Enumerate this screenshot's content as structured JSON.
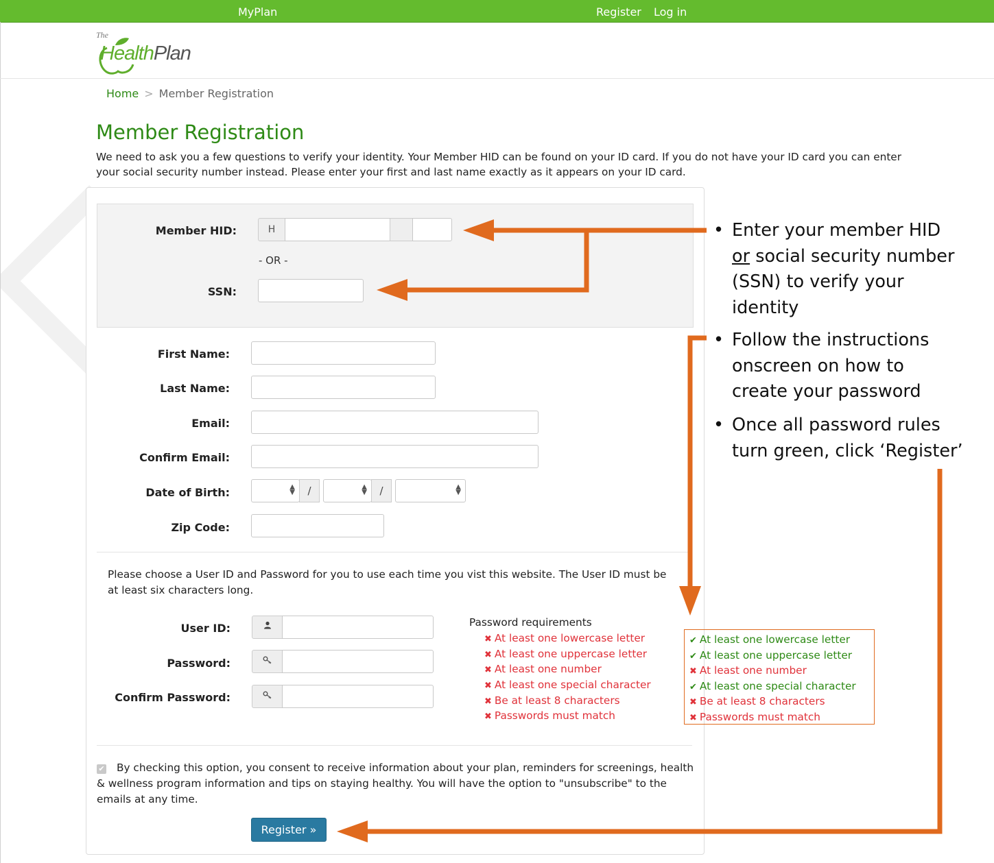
{
  "topbar": {
    "brand": "MyPlan",
    "register": "Register",
    "login": "Log in",
    "color": "#64bb2e"
  },
  "logo": {
    "the": "The",
    "health": "Health",
    "plan": "Plan"
  },
  "breadcrumb": {
    "home": "Home",
    "separator": ">",
    "current": "Member Registration"
  },
  "page": {
    "title": "Member Registration",
    "intro": "We need to ask you a few questions to verify your identity. Your Member HID can be found on your ID card. If you do not have your ID card you can enter your social security number instead. Please enter your first and last name exactly as it appears on your ID card."
  },
  "identity": {
    "hid_label": "Member HID:",
    "hid_prefix": "H",
    "or_text": "- OR -",
    "ssn_label": "SSN:"
  },
  "fields": {
    "first_name": "First Name:",
    "last_name": "Last Name:",
    "email": "Email:",
    "confirm_email": "Confirm Email:",
    "dob": "Date of Birth:",
    "dob_sep": "/",
    "zip": "Zip Code:"
  },
  "credentials": {
    "instructions": "Please choose a User ID and Password for you to use each time you vist this website. The User ID must be at least six characters long.",
    "user_id": "User ID:",
    "password": "Password:",
    "confirm_password": "Confirm Password:",
    "user_icon": "user-icon",
    "key_icon": "key-icon"
  },
  "password_requirements": {
    "title": "Password requirements",
    "rules": [
      "At least one lowercase letter",
      "At least one uppercase letter",
      "At least one number",
      "At least one special character",
      "Be at least 8 characters",
      "Passwords must match"
    ],
    "example_status": [
      "ok",
      "ok",
      "fail",
      "ok",
      "fail",
      "fail"
    ],
    "ok_color": "#2e8a16",
    "fail_color": "#e0323a"
  },
  "consent": {
    "checked": true,
    "text": "By checking this option, you consent to receive information about your plan, reminders for screenings, health & wellness program information and tips on staying healthy. You will have the option to \"unsubscribe\" to the emails at any time."
  },
  "register_button": {
    "label": "Register »",
    "color": "#2a7aa1"
  },
  "annotations": {
    "arrow_color": "#e06a1e",
    "note1_l1": "Enter your member HID",
    "note1_or": "or",
    "note1_l2": " social security number",
    "note1_l3": "(SSN) to verify your",
    "note1_l4": "identity",
    "note2_l1": "Follow the instructions",
    "note2_l2": "onscreen on how to",
    "note2_l3": "create your password",
    "note3_l1": "Once all password rules",
    "note3_l2": "turn green, click ‘Register’"
  }
}
